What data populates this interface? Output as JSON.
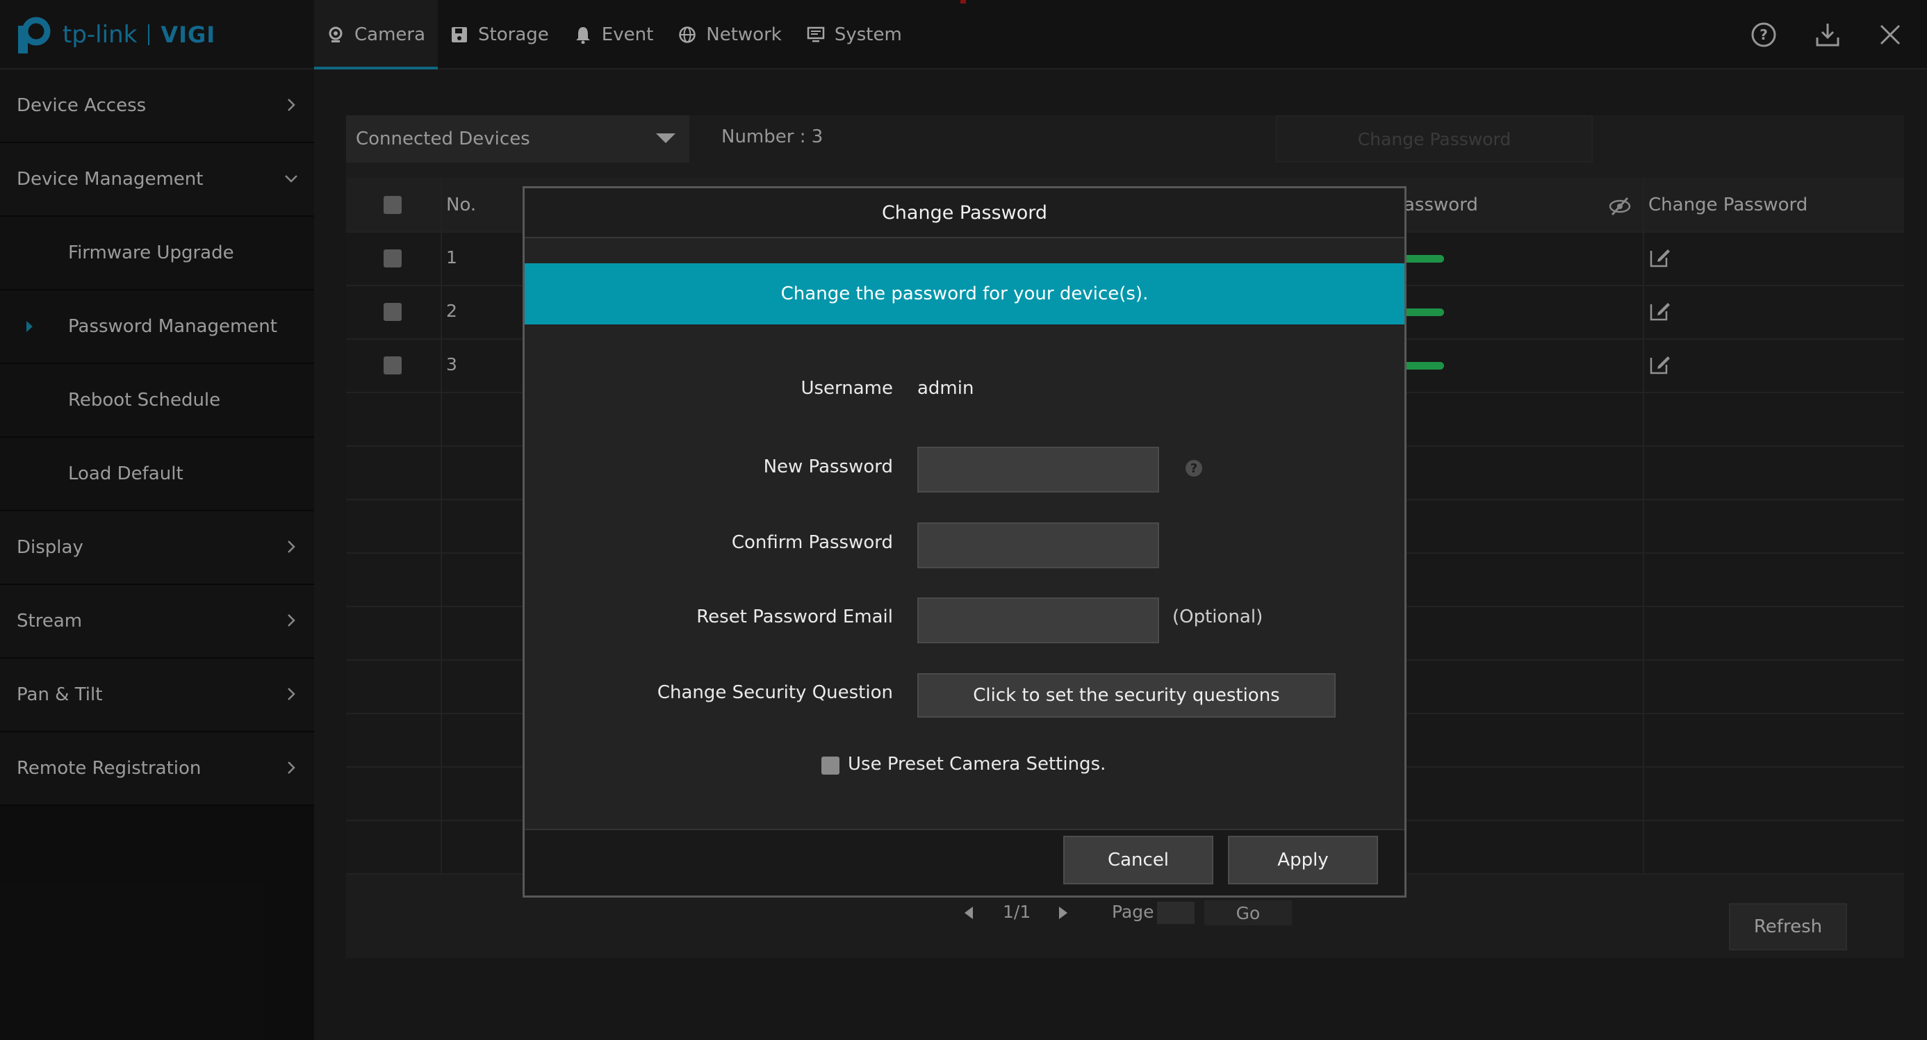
{
  "brand": {
    "logo_text": "tp-link",
    "product": "VIGI"
  },
  "nav": {
    "tabs": [
      {
        "label": "Camera",
        "icon": "camera-icon",
        "active": true
      },
      {
        "label": "Storage",
        "icon": "floppy-disk-icon"
      },
      {
        "label": "Event",
        "icon": "bell-icon"
      },
      {
        "label": "Network",
        "icon": "globe-icon"
      },
      {
        "label": "System",
        "icon": "monitor-icon"
      }
    ],
    "actions": [
      "help-icon",
      "download-icon",
      "close-icon"
    ]
  },
  "sidebar": {
    "items": [
      {
        "label": "Device Access",
        "expanded": false
      },
      {
        "label": "Device Management",
        "expanded": true
      },
      {
        "label": "Firmware Upgrade",
        "sub": true
      },
      {
        "label": "Password Management",
        "sub": true,
        "active": true
      },
      {
        "label": "Reboot Schedule",
        "sub": true
      },
      {
        "label": "Load Default",
        "sub": true
      },
      {
        "label": "Display",
        "expanded": false
      },
      {
        "label": "Stream",
        "expanded": false
      },
      {
        "label": "Pan & Tilt",
        "expanded": false
      },
      {
        "label": "Remote Registration",
        "expanded": false
      }
    ]
  },
  "toolbar": {
    "device_filter": "Connected Devices",
    "number_text": "Number : 3",
    "change_password_label": "Change Password"
  },
  "table": {
    "headers": {
      "no": "No.",
      "password": "assword",
      "change_password": "Change Password"
    },
    "rows": [
      {
        "no": "1",
        "status": "strong"
      },
      {
        "no": "2",
        "status": "strong"
      },
      {
        "no": "3",
        "status": "strong"
      }
    ],
    "status_color": "#2ee06e"
  },
  "pagination": {
    "page_info": "1/1",
    "page_label": "Page",
    "go_label": "Go"
  },
  "refresh_label": "Refresh",
  "modal": {
    "title": "Change Password",
    "banner": "Change the password for your device(s).",
    "banner_color": "#0497ab",
    "fields": {
      "username_label": "Username",
      "username_value": "admin",
      "new_password_label": "New Password",
      "confirm_password_label": "Confirm Password",
      "reset_email_label": "Reset Password Email",
      "optional_note": "(Optional)",
      "security_question_label": "Change Security Question",
      "security_question_button": "Click to set the security questions",
      "preset_label": "Use Preset Camera Settings."
    },
    "cancel_label": "Cancel",
    "apply_label": "Apply"
  },
  "accent_color": "#1a9fc7"
}
